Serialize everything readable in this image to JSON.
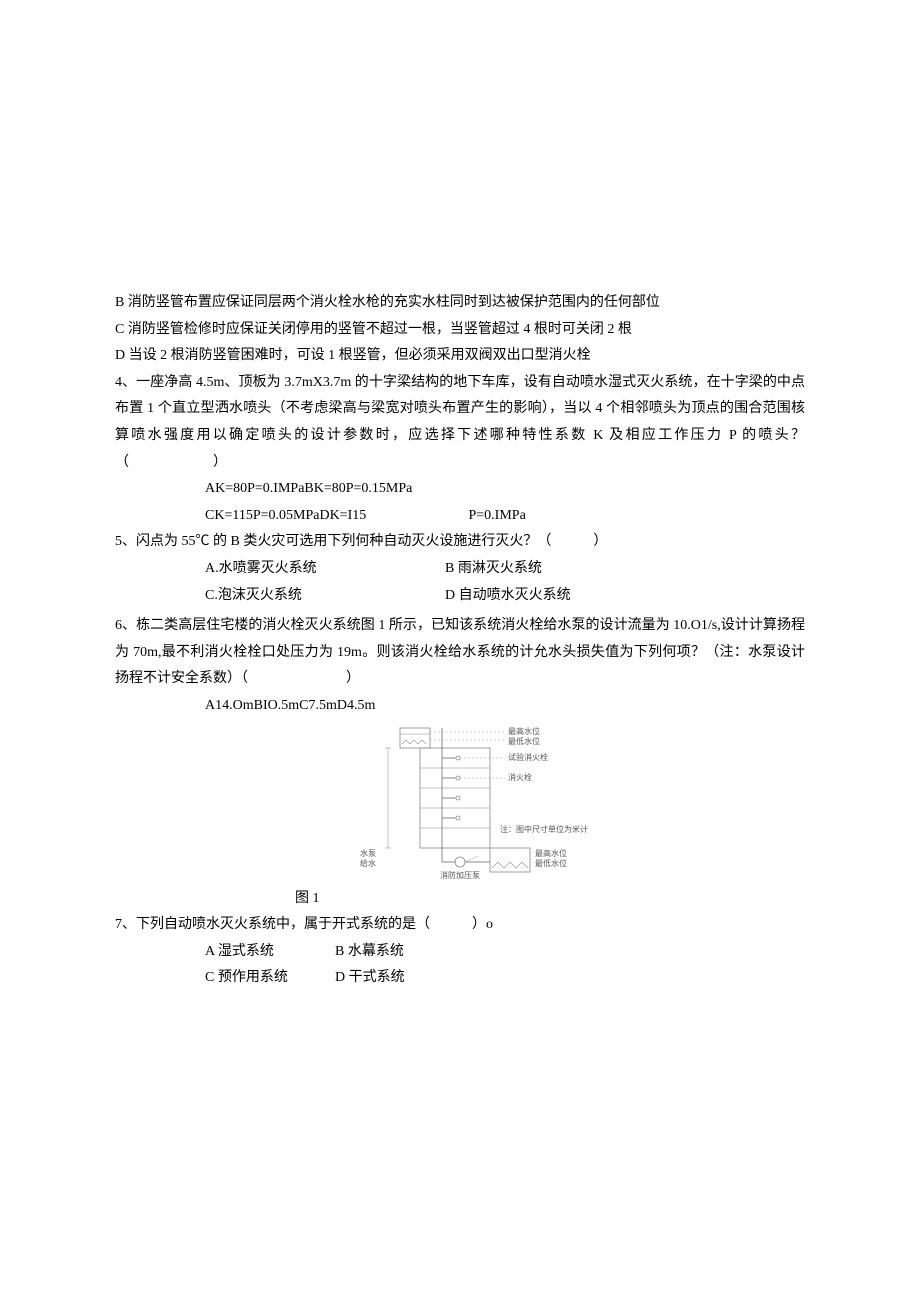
{
  "q_pre": {
    "b": "B 消防竖管布置应保证同层两个消火栓水枪的充实水柱同时到达被保护范围内的任何部位",
    "c": "C 消防竖管检修时应保证关闭停用的竖管不超过一根，当竖管超过 4 根时可关闭 2 根",
    "d": "D 当设 2 根消防竖管困难时，可设 1 根竖管，但必须采用双阀双出口型消火栓"
  },
  "q4": {
    "text": "4、一座净高 4.5m、顶板为 3.7mX3.7m 的十字梁结构的地下车库，设有自动喷水湿式灭火系统，在十字梁的中点布置 1 个直立型洒水喷头（不考虑梁高与梁宽对喷头布置产生的影响），当以 4 个相邻喷头为顶点的围合范围核算喷水强度用以确定喷头的设计参数时，应选择下述哪种特性系数 K 及相应工作压力 P 的喷头？（　　　　　　）",
    "opt1": "AK=80P=0.IMPaBK=80P=0.15MPa",
    "opt2a": "CK=115P=0.05MPaDK=I15",
    "opt2b": "P=0.IMPa"
  },
  "q5": {
    "text": "5、闪点为 55℃ 的 B 类火灾可选用下列何种自动灭火设施进行灭火？（　　　）",
    "a": "A.水喷雾灭火系统",
    "b": "B 雨淋灭火系统",
    "c": "C.泡沫灭火系统",
    "d": "D 自动喷水灭火系统"
  },
  "q6": {
    "text": "6、栋二类高层住宅楼的消火栓灭火系统图 1 所示，已知该系统消火栓给水泵的设计流量为 10.O1/s,设计计算扬程为 70m,最不利消火栓栓口处压力为 19m。则该消火栓给水系统的计允水头损失值为下列何项？（注：水泵设计扬程不计安全系数）（　　　　　　　）",
    "opts": "A14.OmBIO.5mC7.5mD4.5m",
    "caption": "图 1",
    "fig_labels": {
      "l1": "最高水位",
      "l2": "最低水位",
      "l3": "试验消火栓",
      "l4": "消火栓",
      "l5": "注：图中尺寸单位为米计",
      "l6": "消防加压泵",
      "l7": "最高水位",
      "l8": "最低水位",
      "side1": "水泵",
      "side2": "给水"
    }
  },
  "q7": {
    "text": "7、下列自动喷水灭火系统中，属于开式系统的是（　　　）o",
    "a": "A 湿式系统",
    "b": "B 水幕系统",
    "c": "C 预作用系统",
    "d": "D 干式系统"
  }
}
